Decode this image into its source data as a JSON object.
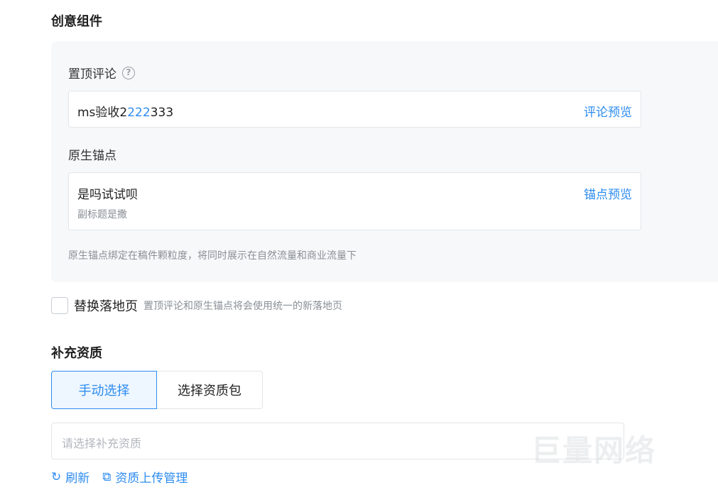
{
  "creative": {
    "title": "创意组件",
    "pinned_comment": {
      "label": "置顶评论",
      "help_icon": "question-circle-icon",
      "value_prefix": "ms验收2",
      "value_highlight": "222",
      "value_suffix": "333",
      "preview_link": "评论预览"
    },
    "anchor": {
      "label": "原生锚点",
      "title": "是吗试试呗",
      "subtitle": "副标题是撒",
      "preview_link": "锚点预览"
    },
    "hint": "原生锚点绑定在稿件颗粒度，将同时展示在自然流量和商业流量下"
  },
  "replace_landing": {
    "checked": false,
    "label": "替换落地页",
    "desc": "置顶评论和原生锚点将会使用统一的新落地页"
  },
  "qualification": {
    "title": "补充资质",
    "tabs": [
      {
        "label": "手动选择",
        "active": true
      },
      {
        "label": "选择资质包",
        "active": false
      }
    ],
    "select_placeholder": "请选择补充资质",
    "actions": [
      {
        "label": "刷新",
        "icon": "refresh-icon"
      },
      {
        "label": "资质上传管理",
        "icon": "external-link-icon"
      }
    ]
  },
  "watermark": "巨量网络",
  "colors": {
    "accent": "#2d8cf0",
    "panel_bg": "#f7f8fa"
  }
}
